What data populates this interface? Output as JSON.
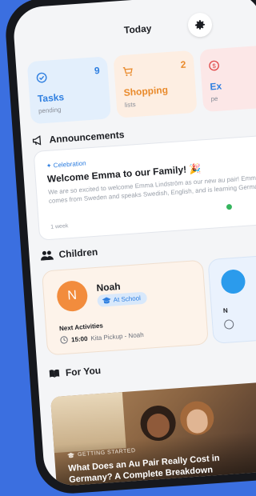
{
  "header": {
    "title": "Today",
    "settings_icon": "gear-icon"
  },
  "quick_cards": [
    {
      "label": "Tasks",
      "count": "9",
      "sub": "pending",
      "icon": "check-circle-icon",
      "color": "#2f7fe0"
    },
    {
      "label": "Shopping",
      "count": "2",
      "sub": "lists",
      "icon": "cart-icon",
      "color": "#e98a2b"
    },
    {
      "label": "Ex",
      "count": "",
      "sub": "pe",
      "icon": "dollar-icon",
      "color": "#e04848"
    }
  ],
  "announcements": {
    "heading": "Announcements",
    "tag": "Celebration",
    "title": "Welcome Emma to our Family! 🎉",
    "body": "We are so excited to welcome Emma Lindström as our new au pair! Emma comes from Sweden and speaks Swedish, English, and is learning German....",
    "time": "1 week"
  },
  "children": {
    "heading": "Children",
    "items": [
      {
        "initial": "N",
        "name": "Noah",
        "status": "At School",
        "next_label": "Next Activities",
        "time": "15:00",
        "activity": "Kita Pickup - Noah"
      },
      {
        "initial": "",
        "name": "",
        "status": "",
        "next_label": "N",
        "time": "",
        "activity": ""
      }
    ]
  },
  "for_you": {
    "heading": "For You",
    "tag": "GETTING STARTED",
    "title": "What Does an Au Pair Really Cost in Germany? A Complete Breakdown"
  },
  "colors": {
    "accent": "#2f7fe0",
    "background": "#3b6fe0",
    "orange": "#f28c3d"
  }
}
